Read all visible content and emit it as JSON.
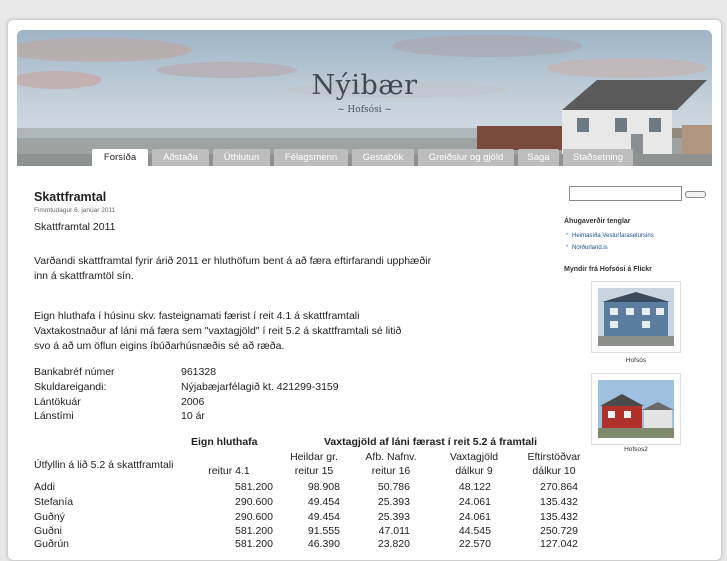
{
  "site": {
    "title": "Nýibær",
    "subtitle": "~ Hofsósi ~"
  },
  "nav": [
    {
      "label": "Forsíða",
      "active": true
    },
    {
      "label": "Aðstaða"
    },
    {
      "label": "Úthlutun"
    },
    {
      "label": "Félagsmenn"
    },
    {
      "label": "Gestabók"
    },
    {
      "label": "Greiðslur og gjöld"
    },
    {
      "label": "Saga"
    },
    {
      "label": "Staðsetning"
    }
  ],
  "post": {
    "title": "Skattframtal",
    "date": "Fimmtudagur 6. janúar 2011",
    "intro": "Skattframtal 2011",
    "para1": [
      "Varðandi skattframtal fyrir árið 2011 er hluthöfum bent á að færa eftirfarandi upphæðir",
      "inn á skattframtöl sín."
    ],
    "para2": [
      "Eign hluthafa í húsinu skv. fasteignamati færist í reit 4.1 á skattframtali",
      "Vaxtakostnaður af láni má færa sem \"vaxtagjöld\" í reit 5.2 á skattframtali sé litið",
      "svo á að um öflun eigins íbúðarhúsnæðis sé að ræða."
    ],
    "bank": [
      {
        "label": "Bankabréf númer",
        "value": "961328"
      },
      {
        "label": "Skuldareigandi:",
        "value": "Nýjabæjarfélagið kt. 421299-3159"
      },
      {
        "label": "Lántökuár",
        "value": "2006"
      },
      {
        "label": "Lánstími",
        "value": "10 ár"
      }
    ],
    "table": {
      "group1": "Eign hluthafa",
      "group2": "Vaxtagjöld af láni færast í reit 5.2 á framtali",
      "row_label_header": "Útfyllin á lið 5.2 á skattframtali",
      "col_top": [
        "",
        "Heildar gr.",
        "Afb. Nafnv.",
        "Vaxtagjöld",
        "Eftirstöðvar"
      ],
      "col_bottom": [
        "reitur 4.1",
        "reitur 15",
        "reitur 16",
        "dálkur 9",
        "dálkur 10"
      ],
      "rows": [
        {
          "name": "Addi",
          "cells": [
            "581.200",
            "98.908",
            "50.786",
            "48.122",
            "270.864"
          ]
        },
        {
          "name": "Stefanía",
          "cells": [
            "290.600",
            "49.454",
            "25.393",
            "24.061",
            "135.432"
          ]
        },
        {
          "name": "Guðný",
          "cells": [
            "290.600",
            "49.454",
            "25.393",
            "24.061",
            "135.432"
          ]
        },
        {
          "name": "Guðni",
          "cells": [
            "581.200",
            "91.555",
            "47.011",
            "44.545",
            "250.729"
          ]
        },
        {
          "name": "Guðrún",
          "cells": [
            "581.200",
            "46.390",
            "23.820",
            "22.570",
            "127.042"
          ]
        }
      ]
    }
  },
  "sidebar": {
    "links_heading": "Áhugaverðir tenglar",
    "links": [
      "Heimasíða Vesturfarasetursins",
      "Norðurland.is"
    ],
    "flickr_heading": "Myndir frá Hofsósi á Flickr",
    "photos": [
      {
        "caption": "Hofsós"
      },
      {
        "caption": "Hofsos2"
      }
    ]
  }
}
